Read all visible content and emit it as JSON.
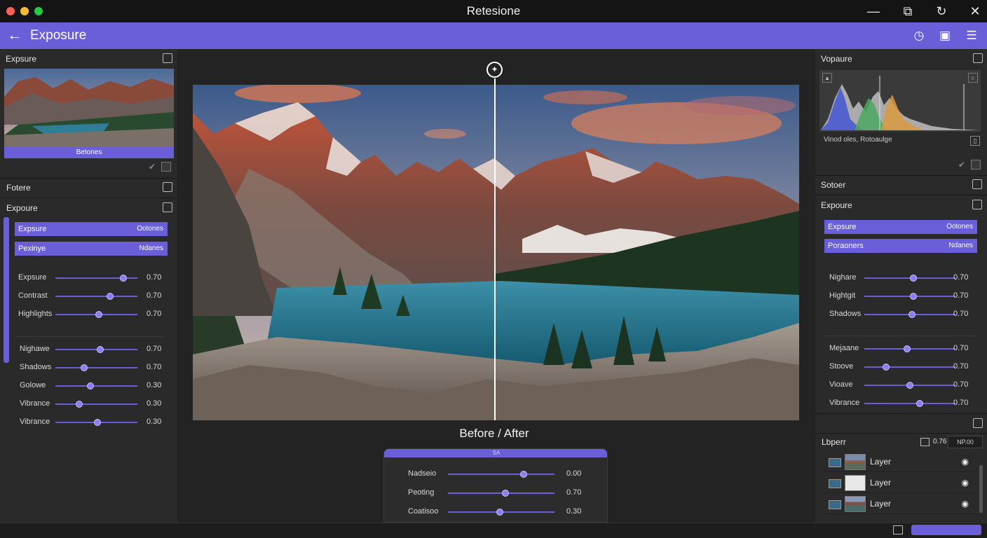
{
  "window": {
    "title": "Retesione",
    "controls": [
      "minimize-icon",
      "restore-icon",
      "refresh-icon",
      "close-icon"
    ]
  },
  "header": {
    "title": "Exposure",
    "back_icon": "arrow-left-icon",
    "icons": [
      "reset-icon",
      "compare-icon",
      "menu-icon"
    ]
  },
  "colors": {
    "accent": "#6a5ed9",
    "panel": "#2a2a2a",
    "titlebar": "#141414",
    "canvas": "#232323"
  },
  "left": {
    "preview_header": "Expsure",
    "preview_caption": "Betones",
    "filters_header": "Fotere",
    "exposure_header": "Expoure",
    "bars": [
      {
        "label": "Expsure",
        "value": "Ootones"
      },
      {
        "label": "Pexinye",
        "value": "Ndanes"
      }
    ],
    "sliders_a": [
      {
        "label": "Expsure",
        "value": "0.70",
        "pos": 0.83
      },
      {
        "label": "Contrast",
        "value": "0.70",
        "pos": 0.67
      },
      {
        "label": "Highlights",
        "value": "0.70",
        "pos": 0.53
      }
    ],
    "sliders_b": [
      {
        "label": "Nighawe",
        "value": "0.70",
        "pos": 0.55
      },
      {
        "label": "Shadows",
        "value": "0.70",
        "pos": 0.35
      },
      {
        "label": "Golowe",
        "value": "0.30",
        "pos": 0.43
      },
      {
        "label": "Vibrance",
        "value": "0.30",
        "pos": 0.29
      },
      {
        "label": "Vibrance",
        "value": "0.30",
        "pos": 0.51
      }
    ]
  },
  "center": {
    "compare_label": "Before / After",
    "panel_cap": "SA",
    "sliders": [
      {
        "label": "Nadseio",
        "value": "0.00",
        "pos": 0.71
      },
      {
        "label": "Peoting",
        "value": "0.70",
        "pos": 0.54
      },
      {
        "label": "Coatisoo",
        "value": "0.30",
        "pos": 0.49
      }
    ]
  },
  "right": {
    "histogram_header": "Vopaure",
    "histogram_caption": "Vinod oles, Rotoaulge",
    "solor_header": "Sotoer",
    "exposure_header": "Expoure",
    "bars": [
      {
        "label": "Expsure",
        "value": "Ootones"
      },
      {
        "label": "Poraoners",
        "value": "Ndanes"
      }
    ],
    "sliders_a": [
      {
        "label": "Nighare",
        "value": "0.70",
        "pos": 0.54
      },
      {
        "label": "Hightgit",
        "value": "0.70",
        "pos": 0.54
      },
      {
        "label": "Shadows",
        "value": "0.70",
        "pos": 0.52
      }
    ],
    "sliders_b": [
      {
        "label": "Mejaane",
        "value": "0.70",
        "pos": 0.47
      },
      {
        "label": "Stoove",
        "value": "0.70",
        "pos": 0.24
      },
      {
        "label": "Vioave",
        "value": "0.70",
        "pos": 0.5
      },
      {
        "label": "Vibrance",
        "value": "0.70",
        "pos": 0.61
      }
    ],
    "layers_header": "Lbperr",
    "layers_opacity": "0.76",
    "layers_mode": "NP.00",
    "layers": [
      {
        "name": "Layer"
      },
      {
        "name": "Layer"
      },
      {
        "name": "Layer"
      }
    ]
  }
}
